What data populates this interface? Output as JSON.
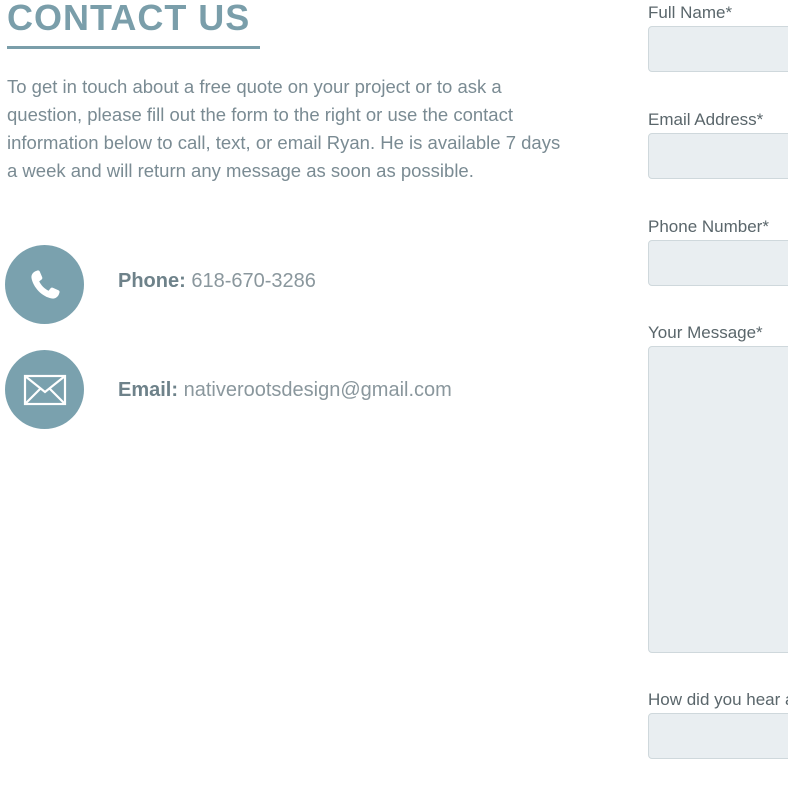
{
  "header": {
    "title": "CONTACT US"
  },
  "intro": {
    "text": "To get in touch about a free quote on your project or to ask a question, please fill out the form to the right or use the contact information below to call, text, or email Ryan. He is available 7 days a week and will return any message as soon as possible."
  },
  "contacts": {
    "phone": {
      "label": "Phone:",
      "value": "618-670-3286",
      "icon": "phone-icon"
    },
    "email": {
      "label": "Email:",
      "value": "nativerootsdesign@gmail.com",
      "icon": "envelope-icon"
    }
  },
  "form": {
    "fields": [
      {
        "label": "Full Name*",
        "value": ""
      },
      {
        "label": "Email Address*",
        "value": ""
      },
      {
        "label": "Phone Number*",
        "value": ""
      },
      {
        "label": "Your Message*",
        "value": ""
      },
      {
        "label": "How did you hear about us?",
        "value": ""
      }
    ]
  },
  "colors": {
    "accent": "#7aa1ae",
    "text": "#7a8b93",
    "input_bg": "#e9eef1"
  }
}
